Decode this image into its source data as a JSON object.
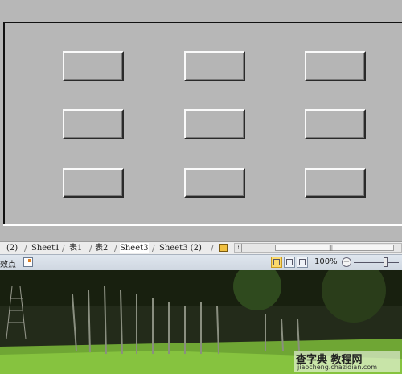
{
  "sheet_tabs": [
    "(2)",
    "Sheet1",
    "表1",
    "表2",
    "Sheet3",
    "Sheet3 (2)"
  ],
  "statusbar": {
    "left_text": "效点",
    "zoom": "100%",
    "zoom_minus": "−"
  },
  "scrollbar": {
    "handle": "⁞",
    "grip": "|||"
  },
  "watermark": {
    "text": "查字典  教程网",
    "url": "jiaocheng.chazidian.com"
  },
  "colors": {
    "form_bg": "#b7b7b7",
    "button_face": "#b5b5b5",
    "statusbar": "#dfe6ee"
  },
  "icons": {
    "nav": "sheet-nav-icon",
    "macro": "macro-record-icon",
    "views": [
      "normal-view-icon",
      "page-layout-icon",
      "page-break-preview-icon"
    ]
  }
}
